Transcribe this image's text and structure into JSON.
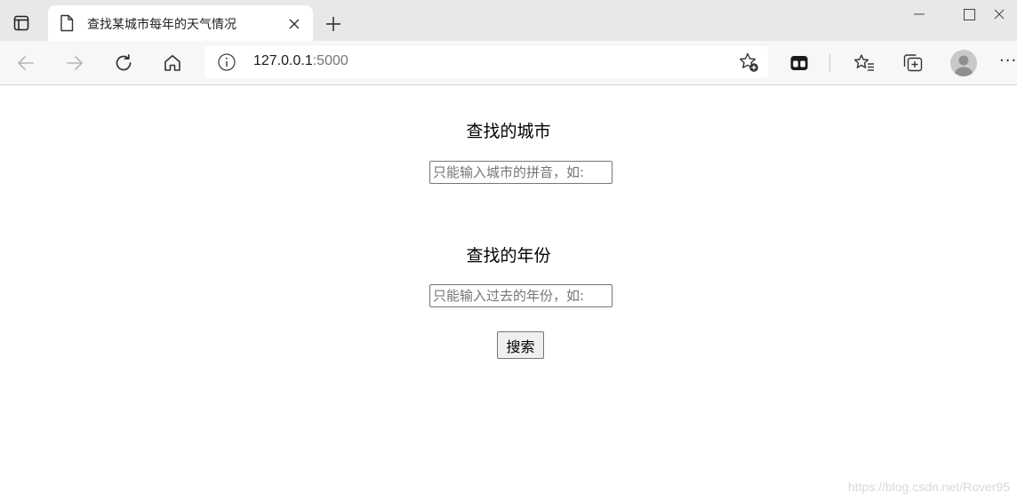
{
  "browser": {
    "tab": {
      "title": "查找某城市每年的天气情况"
    },
    "address": {
      "host": "127.0.0.1",
      "port": ":5000"
    }
  },
  "form": {
    "city_label": "查找的城市",
    "city_placeholder": "只能输入城市的拼音，如:",
    "year_label": "查找的年份",
    "year_placeholder": "只能输入过去的年份，如:",
    "search_label": "搜索"
  },
  "watermark": "https://blog.csdn.net/Rover95",
  "icons": {
    "tab_actions": "tab-actions-icon",
    "favicon": "page-icon",
    "close": "close-icon",
    "new_tab": "plus-icon",
    "back": "back-arrow-icon",
    "forward": "forward-arrow-icon",
    "refresh": "refresh-icon",
    "home": "home-icon",
    "info": "info-icon",
    "favorite_add": "star-plus-icon",
    "extension": "extension-icon",
    "favorites": "favorites-icon",
    "collections": "collections-icon",
    "profile": "avatar",
    "more": "more-icon"
  }
}
